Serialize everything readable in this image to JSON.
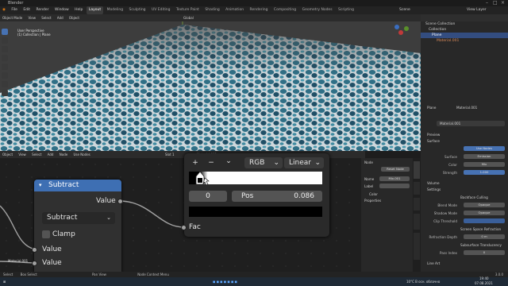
{
  "window": {
    "title": "Blender"
  },
  "menu": {
    "items": [
      "File",
      "Edit",
      "Render",
      "Window",
      "Help"
    ],
    "workspaces": [
      "Layout",
      "Modeling",
      "Sculpting",
      "UV Editing",
      "Texture Paint",
      "Shading",
      "Animation",
      "Rendering",
      "Compositing",
      "Geometry Nodes",
      "Scripting"
    ],
    "scene": "Scene",
    "view_layer": "View Layer"
  },
  "viewport": {
    "mode": "Object Mode",
    "menus": [
      "View",
      "Select",
      "Add",
      "Object"
    ],
    "transform": "Global",
    "info_line1": "User Perspective",
    "info_line2": "(1) Collection | Plane"
  },
  "outliner": {
    "title": "Scene Collection",
    "rows": [
      "Collection",
      "Plane",
      "Material.001"
    ]
  },
  "properties": {
    "object": "Plane",
    "material_slot": "Material.001",
    "material_name": "Material.001",
    "sections": [
      "Preview",
      "Surface",
      "Volume",
      "Settings",
      "Line Art"
    ],
    "surface": "Use Nodes",
    "surface_shader": "Emission",
    "color_label": "Color",
    "color_value": "Mix",
    "strength_label": "Strength",
    "strength_value": "1.000",
    "backface": "Backface Culling",
    "blend_mode_label": "Blend Mode",
    "blend_mode": "Opaque",
    "shadow_mode_label": "Shadow Mode",
    "shadow_mode": "Opaque",
    "clip_threshold": "Clip Threshold",
    "ssr": "Screen Space Refraction",
    "refraction_depth_label": "Refraction Depth",
    "refraction_depth": "0 m",
    "subsurface": "Subsurface Translucency",
    "pass_index_label": "Pass Index",
    "pass_index": "0"
  },
  "node_editor": {
    "menus": [
      "Object",
      "View",
      "Select",
      "Add",
      "Node"
    ],
    "use_nodes": "Use Nodes",
    "slot": "Slot 1",
    "material": "Material.001"
  },
  "node": {
    "title": "Subtract",
    "output": "Value",
    "operation": "Subtract",
    "clamp": "Clamp",
    "input1": "Value",
    "input2": "Value",
    "ext_label": "Material.001"
  },
  "color_ramp": {
    "plus": "+",
    "minus": "−",
    "chevron": "⌄",
    "color_mode": "RGB",
    "interpolation": "Linear",
    "index": "0",
    "pos_label": "Pos",
    "pos_value": "0.086",
    "fac": "Fac"
  },
  "node_sidebar": {
    "tab": "Node",
    "header": "Node",
    "reset": "Reset Node",
    "name_label": "Name",
    "name_value": "Mix.001",
    "label_label": "Label",
    "color": "Color",
    "properties": "Properties",
    "tabs": [
      "Node",
      "Tool",
      "View",
      "Options",
      "Node Wrangler"
    ]
  },
  "status": {
    "items": [
      "Select",
      "Box Select",
      "Pan View",
      "Node Context Menu"
    ],
    "version": "3.0.0"
  },
  "taskbar": {
    "weather": "10°C  В осн. облачно",
    "time": "19:40",
    "date": "07.08.2021"
  }
}
